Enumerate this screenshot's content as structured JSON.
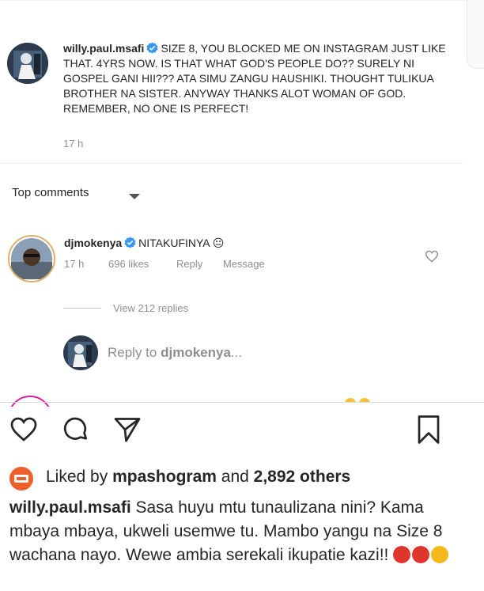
{
  "post_caption": {
    "username": "willy.paul.msafi",
    "text": "SIZE 8, YOU BLOCKED ME ON INSTAGRAM JUST LIKE THAT. 4YRS NOW. IS THAT WHAT GOD'S PEOPLE DO?? SURELY NI GOSPEL GANI HII??? ATA SIMU ZANGU HAUSHIKI. THOUGHT TULIKUA BROTHER NA SISTER. ANYWAY THANKS ALOT WOMAN OF GOD. REMEMBER,  NO ONE IS PERFECT!",
    "time": "17 h"
  },
  "comments_section": {
    "title": "Top comments"
  },
  "top_comment": {
    "username": "djmokenya",
    "text": "NITAKUFINYA 😐",
    "time": "17 h",
    "likes": "696 likes",
    "reply_label": "Reply",
    "message_label": "Message",
    "view_replies": "View 212 replies"
  },
  "reply_box": {
    "prefix": "Reply to ",
    "target": "djmokenya",
    "suffix": "..."
  },
  "actions": {
    "like": "heart-icon",
    "comment": "comment-icon",
    "share": "send-icon",
    "save": "bookmark-icon"
  },
  "liked_by": {
    "prefix": "Liked by ",
    "user": "mpashogram",
    "middle": " and ",
    "count": "2,892 others"
  },
  "bottom_caption": {
    "username": "willy.paul.msafi",
    "text": "Sasa huyu mtu tunaulizana nini? Kama mbaya mbaya, ukweli usemwe tu. Mambo yangu na Size 8 wachana nayo. Wewe ambia serekali ikupatie kazi!!"
  },
  "colors": {
    "verified": "#3897f0",
    "muted": "#8e8e8e",
    "text": "#262626"
  }
}
